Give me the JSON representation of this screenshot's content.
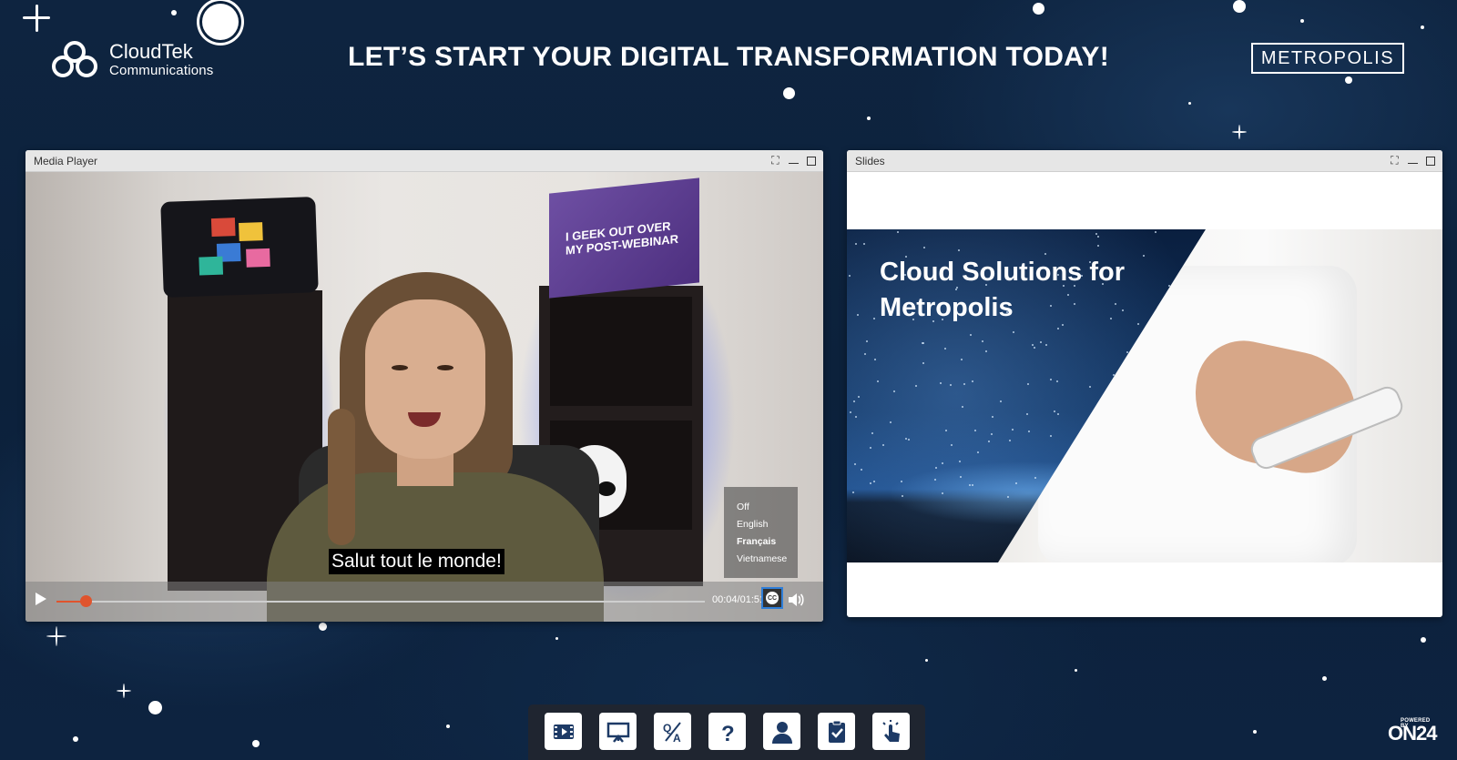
{
  "header": {
    "logo_name": "CloudTek",
    "logo_sub": "Communications",
    "headline": "LET’S START YOUR DIGITAL TRANSFORMATION TODAY!",
    "badge": "METROPOLIS"
  },
  "media_player": {
    "title": "Media Player",
    "caption": "Salut tout le monde!",
    "time": "00:04/01:51",
    "progress": 0.045,
    "cc_options": [
      "Off",
      "English",
      "Français",
      "Vietnamese"
    ],
    "cc_selected": "Français",
    "cc_icon": "cc-icon",
    "volume_icon": "volume-icon"
  },
  "slides": {
    "title": "Slides",
    "slide_heading_line1": "Cloud Solutions for",
    "slide_heading_line2": "Metropolis"
  },
  "toolbar": {
    "tools": [
      "media-player-icon",
      "slides-icon",
      "translate-icon",
      "help-icon",
      "speaker-icon",
      "survey-icon",
      "engagement-icon"
    ]
  },
  "footer": {
    "powered_by": "POWERED BY",
    "brand": "ON24"
  },
  "colors": {
    "background": "#0d2340",
    "accent": "#e0542d",
    "cc_highlight": "#2f7ed8"
  }
}
